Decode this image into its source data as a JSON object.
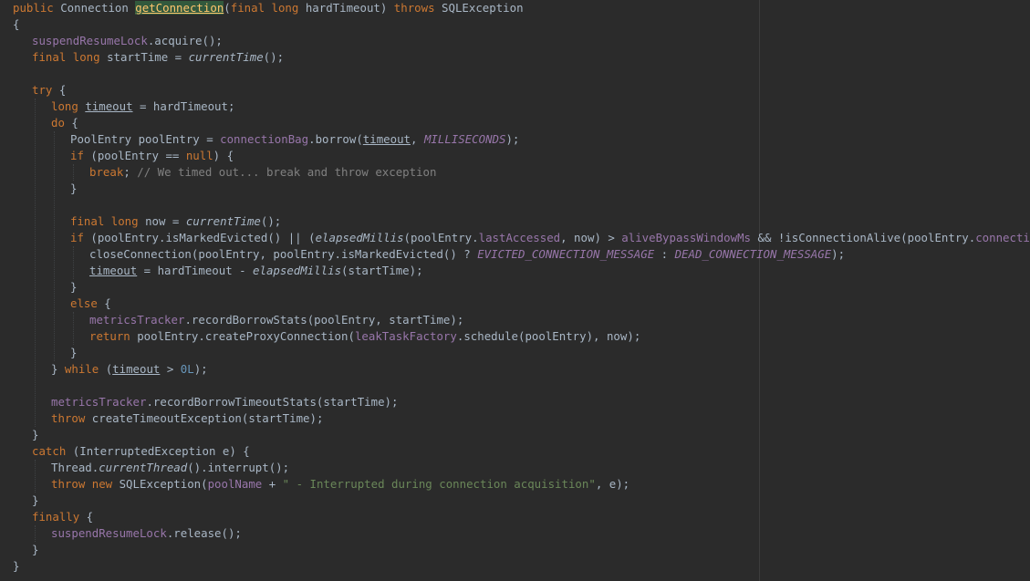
{
  "editor": {
    "language": "Java",
    "theme": "Darcula",
    "lines": [
      {
        "indent": 0,
        "tokens": [
          {
            "t": "public",
            "k": "keyword"
          },
          {
            "t": " Connection ",
            "k": "plain"
          },
          {
            "t": "getConnection",
            "k": "highlight"
          },
          {
            "t": "(",
            "k": "plain"
          },
          {
            "t": "final long",
            "k": "keyword"
          },
          {
            "t": " hardTimeout) ",
            "k": "plain"
          },
          {
            "t": "throws",
            "k": "keyword"
          },
          {
            "t": " SQLException",
            "k": "plain"
          }
        ]
      },
      {
        "indent": 0,
        "tokens": [
          {
            "t": "{",
            "k": "plain"
          }
        ]
      },
      {
        "indent": 1,
        "tokens": [
          {
            "t": "suspendResumeLock",
            "k": "field"
          },
          {
            "t": ".acquire();",
            "k": "plain"
          }
        ]
      },
      {
        "indent": 1,
        "tokens": [
          {
            "t": "final long",
            "k": "keyword"
          },
          {
            "t": " startTime = ",
            "k": "plain"
          },
          {
            "t": "currentTime",
            "k": "italic"
          },
          {
            "t": "();",
            "k": "plain"
          }
        ]
      },
      {
        "indent": 0,
        "tokens": []
      },
      {
        "indent": 1,
        "tokens": [
          {
            "t": "try",
            "k": "keyword"
          },
          {
            "t": " {",
            "k": "plain"
          }
        ]
      },
      {
        "indent": 2,
        "tokens": [
          {
            "t": "long",
            "k": "keyword"
          },
          {
            "t": " ",
            "k": "plain"
          },
          {
            "t": "timeout",
            "k": "under"
          },
          {
            "t": " = hardTimeout;",
            "k": "plain"
          }
        ]
      },
      {
        "indent": 2,
        "tokens": [
          {
            "t": "do",
            "k": "keyword"
          },
          {
            "t": " {",
            "k": "plain"
          }
        ]
      },
      {
        "indent": 3,
        "tokens": [
          {
            "t": "PoolEntry poolEntry = ",
            "k": "plain"
          },
          {
            "t": "connectionBag",
            "k": "field"
          },
          {
            "t": ".borrow(",
            "k": "plain"
          },
          {
            "t": "timeout",
            "k": "under"
          },
          {
            "t": ", ",
            "k": "plain"
          },
          {
            "t": "MILLISECONDS",
            "k": "static"
          },
          {
            "t": ");",
            "k": "plain"
          }
        ]
      },
      {
        "indent": 3,
        "tokens": [
          {
            "t": "if",
            "k": "keyword"
          },
          {
            "t": " (poolEntry == ",
            "k": "plain"
          },
          {
            "t": "null",
            "k": "keyword"
          },
          {
            "t": ") {",
            "k": "plain"
          }
        ]
      },
      {
        "indent": 4,
        "tokens": [
          {
            "t": "break",
            "k": "keyword"
          },
          {
            "t": "; ",
            "k": "plain"
          },
          {
            "t": "// We timed out... break and throw exception",
            "k": "comment"
          }
        ]
      },
      {
        "indent": 3,
        "tokens": [
          {
            "t": "}",
            "k": "plain"
          }
        ]
      },
      {
        "indent": 0,
        "tokens": []
      },
      {
        "indent": 3,
        "tokens": [
          {
            "t": "final long",
            "k": "keyword"
          },
          {
            "t": " now = ",
            "k": "plain"
          },
          {
            "t": "currentTime",
            "k": "italic"
          },
          {
            "t": "();",
            "k": "plain"
          }
        ]
      },
      {
        "indent": 3,
        "tokens": [
          {
            "t": "if",
            "k": "keyword"
          },
          {
            "t": " (poolEntry.isMarkedEvicted() || (",
            "k": "plain"
          },
          {
            "t": "elapsedMillis",
            "k": "italic"
          },
          {
            "t": "(poolEntry.",
            "k": "plain"
          },
          {
            "t": "lastAccessed",
            "k": "field"
          },
          {
            "t": ", now) > ",
            "k": "plain"
          },
          {
            "t": "aliveBypassWindowMs",
            "k": "field"
          },
          {
            "t": " && !isConnectionAlive(poolEntry.",
            "k": "plain"
          },
          {
            "t": "connection",
            "k": "field"
          },
          {
            "t": "))) {",
            "k": "plain"
          }
        ]
      },
      {
        "indent": 4,
        "tokens": [
          {
            "t": "closeConnection(poolEntry, poolEntry.isMarkedEvicted() ? ",
            "k": "plain"
          },
          {
            "t": "EVICTED_CONNECTION_MESSAGE",
            "k": "static"
          },
          {
            "t": " : ",
            "k": "plain"
          },
          {
            "t": "DEAD_CONNECTION_MESSAGE",
            "k": "static"
          },
          {
            "t": ");",
            "k": "plain"
          }
        ]
      },
      {
        "indent": 4,
        "tokens": [
          {
            "t": "timeout",
            "k": "under"
          },
          {
            "t": " = hardTimeout - ",
            "k": "plain"
          },
          {
            "t": "elapsedMillis",
            "k": "italic"
          },
          {
            "t": "(startTime);",
            "k": "plain"
          }
        ]
      },
      {
        "indent": 3,
        "tokens": [
          {
            "t": "}",
            "k": "plain"
          }
        ]
      },
      {
        "indent": 3,
        "tokens": [
          {
            "t": "else",
            "k": "keyword"
          },
          {
            "t": " {",
            "k": "plain"
          }
        ]
      },
      {
        "indent": 4,
        "tokens": [
          {
            "t": "metricsTracker",
            "k": "field"
          },
          {
            "t": ".recordBorrowStats(poolEntry, startTime);",
            "k": "plain"
          }
        ]
      },
      {
        "indent": 4,
        "tokens": [
          {
            "t": "return",
            "k": "keyword"
          },
          {
            "t": " poolEntry.createProxyConnection(",
            "k": "plain"
          },
          {
            "t": "leakTaskFactory",
            "k": "field"
          },
          {
            "t": ".schedule(poolEntry), now);",
            "k": "plain"
          }
        ]
      },
      {
        "indent": 3,
        "tokens": [
          {
            "t": "}",
            "k": "plain"
          }
        ]
      },
      {
        "indent": 2,
        "tokens": [
          {
            "t": "} ",
            "k": "plain"
          },
          {
            "t": "while",
            "k": "keyword"
          },
          {
            "t": " (",
            "k": "plain"
          },
          {
            "t": "timeout",
            "k": "under"
          },
          {
            "t": " > ",
            "k": "plain"
          },
          {
            "t": "0L",
            "k": "number"
          },
          {
            "t": ");",
            "k": "plain"
          }
        ]
      },
      {
        "indent": 0,
        "tokens": []
      },
      {
        "indent": 2,
        "tokens": [
          {
            "t": "metricsTracker",
            "k": "field"
          },
          {
            "t": ".recordBorrowTimeoutStats(startTime);",
            "k": "plain"
          }
        ]
      },
      {
        "indent": 2,
        "tokens": [
          {
            "t": "throw",
            "k": "keyword"
          },
          {
            "t": " createTimeoutException(startTime);",
            "k": "plain"
          }
        ]
      },
      {
        "indent": 1,
        "tokens": [
          {
            "t": "}",
            "k": "plain"
          }
        ]
      },
      {
        "indent": 1,
        "tokens": [
          {
            "t": "catch",
            "k": "keyword"
          },
          {
            "t": " (InterruptedException e) {",
            "k": "plain"
          }
        ]
      },
      {
        "indent": 2,
        "tokens": [
          {
            "t": "Thread.",
            "k": "plain"
          },
          {
            "t": "currentThread",
            "k": "italic"
          },
          {
            "t": "().interrupt();",
            "k": "plain"
          }
        ]
      },
      {
        "indent": 2,
        "tokens": [
          {
            "t": "throw new",
            "k": "keyword"
          },
          {
            "t": " SQLException(",
            "k": "plain"
          },
          {
            "t": "poolName",
            "k": "field"
          },
          {
            "t": " + ",
            "k": "plain"
          },
          {
            "t": "\" - Interrupted during connection acquisition\"",
            "k": "string"
          },
          {
            "t": ", e);",
            "k": "plain"
          }
        ]
      },
      {
        "indent": 1,
        "tokens": [
          {
            "t": "}",
            "k": "plain"
          }
        ]
      },
      {
        "indent": 1,
        "tokens": [
          {
            "t": "finally",
            "k": "keyword"
          },
          {
            "t": " {",
            "k": "plain"
          }
        ]
      },
      {
        "indent": 2,
        "tokens": [
          {
            "t": "suspendResumeLock",
            "k": "field"
          },
          {
            "t": ".release();",
            "k": "plain"
          }
        ]
      },
      {
        "indent": 1,
        "tokens": [
          {
            "t": "}",
            "k": "plain"
          }
        ]
      },
      {
        "indent": 0,
        "tokens": [
          {
            "t": "}",
            "k": "plain"
          }
        ]
      }
    ]
  },
  "colors": {
    "background": "#2b2b2b",
    "keyword": "#cc7832",
    "plain": "#a9b7c6",
    "field": "#9876aa",
    "string": "#6a8759",
    "number": "#6897bb",
    "comment": "#808080",
    "method_highlight_bg": "#32593d",
    "method_highlight_fg": "#ffc66d"
  }
}
